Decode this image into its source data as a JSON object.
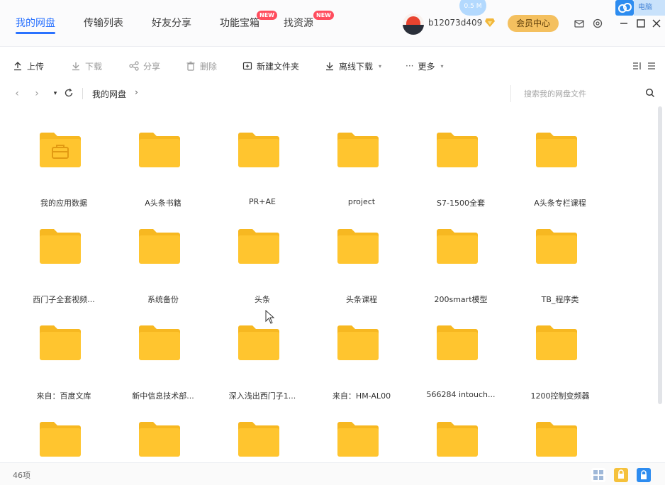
{
  "nav": {
    "tabs": [
      {
        "label": "我的网盘",
        "active": true
      },
      {
        "label": "传输列表"
      },
      {
        "label": "好友分享"
      },
      {
        "label": "功能宝箱",
        "badge": "NEW"
      },
      {
        "label": "找资源",
        "badge": "NEW"
      }
    ],
    "username": "b12073d409",
    "vip_button": "会员中心",
    "float_ball_text": "0.5 M",
    "corner_label": "电脑"
  },
  "toolbar": {
    "upload": "上传",
    "download": "下载",
    "share": "分享",
    "delete": "删除",
    "new_folder": "新建文件夹",
    "offline_download": "离线下载",
    "more": "更多"
  },
  "address": {
    "breadcrumb": "我的网盘",
    "search_placeholder": "搜索我的网盘文件"
  },
  "items": [
    {
      "name": "我的应用数据",
      "app": true
    },
    {
      "name": "A头条书籍"
    },
    {
      "name": "PR+AE"
    },
    {
      "name": "project"
    },
    {
      "name": "S7-1500全套"
    },
    {
      "name": "A头条专栏课程"
    },
    {
      "name": "西门子全套视频..."
    },
    {
      "name": "系统备份"
    },
    {
      "name": "头条"
    },
    {
      "name": "头条课程"
    },
    {
      "name": "200smart模型"
    },
    {
      "name": "TB_程序类"
    },
    {
      "name": "来自：百度文库"
    },
    {
      "name": "新中信息技术部..."
    },
    {
      "name": "深入浅出西门子1..."
    },
    {
      "name": "来自：HM-AL00"
    },
    {
      "name": "566284 intouch..."
    },
    {
      "name": "1200控制变频器"
    },
    {
      "name": ""
    },
    {
      "name": ""
    },
    {
      "name": ""
    },
    {
      "name": ""
    },
    {
      "name": ""
    },
    {
      "name": ""
    }
  ],
  "status": {
    "count": "46项"
  },
  "colors": {
    "accent": "#2a72ff",
    "folder": "#ffc52f",
    "folder_tab": "#f7b821",
    "vip": "#f4c05f"
  }
}
